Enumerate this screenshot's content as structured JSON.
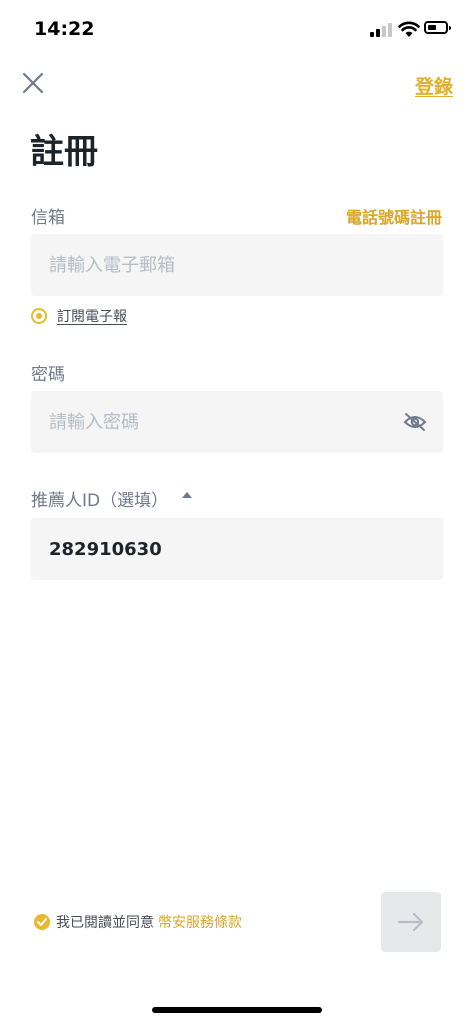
{
  "status_bar": {
    "time": "14:22"
  },
  "header": {
    "login_label": "登錄"
  },
  "page": {
    "title": "註冊"
  },
  "email": {
    "label": "信箱",
    "switch_label": "電話號碼註冊",
    "placeholder": "請輸入電子郵箱",
    "value": ""
  },
  "subscribe": {
    "label": "訂閱電子報",
    "checked": true
  },
  "password": {
    "label": "密碼",
    "placeholder": "請輸入密碼",
    "value": ""
  },
  "referral": {
    "label": "推薦人ID（選填）",
    "value": "282910630"
  },
  "terms": {
    "prefix": "我已閱讀並同意",
    "link_label": "幣安服務條款",
    "checked": true
  },
  "colors": {
    "accent": "#e7b92f",
    "link": "#d8a72a",
    "field_bg": "#f5f5f5",
    "button_disabled": "#e6e8ea"
  }
}
